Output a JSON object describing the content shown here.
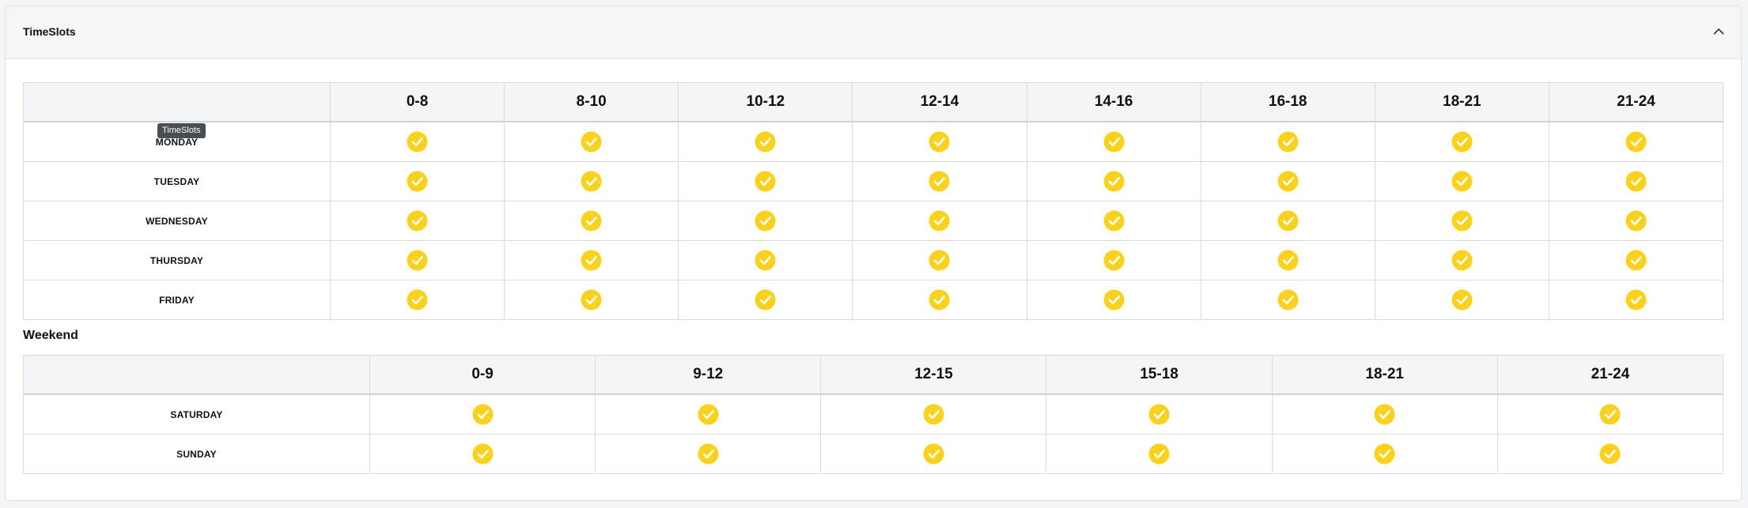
{
  "panel": {
    "title": "TimeSlots",
    "tooltip": "TimeSlots"
  },
  "weekdays": {
    "columns": [
      "0-8",
      "8-10",
      "10-12",
      "12-14",
      "14-16",
      "16-18",
      "18-21",
      "21-24"
    ],
    "rows": [
      {
        "day": "MONDAY",
        "slots": [
          true,
          true,
          true,
          true,
          true,
          true,
          true,
          true
        ]
      },
      {
        "day": "TUESDAY",
        "slots": [
          true,
          true,
          true,
          true,
          true,
          true,
          true,
          true
        ]
      },
      {
        "day": "WEDNESDAY",
        "slots": [
          true,
          true,
          true,
          true,
          true,
          true,
          true,
          true
        ]
      },
      {
        "day": "THURSDAY",
        "slots": [
          true,
          true,
          true,
          true,
          true,
          true,
          true,
          true
        ]
      },
      {
        "day": "FRIDAY",
        "slots": [
          true,
          true,
          true,
          true,
          true,
          true,
          true,
          true
        ]
      }
    ]
  },
  "weekend": {
    "title": "Weekend",
    "columns": [
      "0-9",
      "9-12",
      "12-15",
      "15-18",
      "18-21",
      "21-24"
    ],
    "rows": [
      {
        "day": "SATURDAY",
        "slots": [
          true,
          true,
          true,
          true,
          true,
          true
        ]
      },
      {
        "day": "SUNDAY",
        "slots": [
          true,
          true,
          true,
          true,
          true,
          true
        ]
      }
    ]
  },
  "colors": {
    "check": "#fad21e",
    "checkmark": "#ffffff"
  },
  "icons": {
    "slot": "check-circle-icon",
    "collapse": "chevron-up-icon"
  }
}
